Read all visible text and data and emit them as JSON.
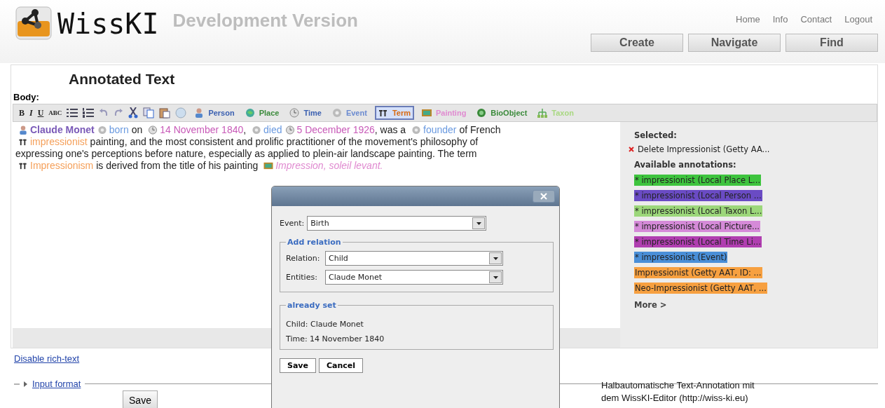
{
  "header": {
    "logo_text": "WissKI",
    "subtitle": "Development Version",
    "top_links": [
      "Home",
      "Info",
      "Contact",
      "Logout"
    ],
    "nav_buttons": [
      "Create",
      "Navigate",
      "Find"
    ]
  },
  "page_title": "Annotated Text",
  "body_label": "Body:",
  "toolbar": {
    "format_buttons": [
      {
        "kind": "bold",
        "label": "B"
      },
      {
        "kind": "italic",
        "label": "I"
      },
      {
        "kind": "underline",
        "label": "U"
      },
      {
        "kind": "spell",
        "label": "ABC"
      }
    ],
    "annotation_buttons": [
      {
        "label": "Person",
        "kind": "person",
        "color": "#3a5fb0",
        "selected": false
      },
      {
        "label": "Place",
        "kind": "place",
        "color": "#3a8a3a",
        "selected": false
      },
      {
        "label": "Time",
        "kind": "time",
        "color": "#3a5fb0",
        "selected": false
      },
      {
        "label": "Event",
        "kind": "event",
        "color": "#6a8ad0",
        "selected": false
      },
      {
        "label": "Term",
        "kind": "term",
        "color": "#d86a10",
        "selected": true
      },
      {
        "label": "Painting",
        "kind": "painting",
        "color": "#e08ad0",
        "selected": false
      },
      {
        "label": "BioObject",
        "kind": "bio",
        "color": "#3a8a3a",
        "selected": false
      },
      {
        "label": "Taxon",
        "kind": "taxon",
        "color": "#a8d880",
        "selected": false
      }
    ]
  },
  "editor": {
    "segments": [
      {
        "kind": "person",
        "text": "Claude Monet",
        "color": "#7a5ab8"
      },
      {
        "kind": "event",
        "text": "born",
        "color": "#6a9ae0"
      },
      {
        "kind": "plain",
        "text": " on "
      },
      {
        "kind": "time",
        "text": "14 November 1840",
        "color": "#c85ab8"
      },
      {
        "kind": "plain",
        "text": ", "
      },
      {
        "kind": "event",
        "text": "died",
        "color": "#6a9ae0"
      },
      {
        "kind": "time",
        "text": "5 December 1926",
        "color": "#c85ab8"
      },
      {
        "kind": "plain",
        "text": ", was a "
      },
      {
        "kind": "event",
        "text": "founder",
        "color": "#6a9ae0"
      },
      {
        "kind": "plain",
        "text": " of French"
      },
      {
        "kind": "break"
      },
      {
        "kind": "term",
        "text": "impressionist",
        "color": "#f5a05a"
      },
      {
        "kind": "plain",
        "text": " painting, and the most consistent and prolific practitioner of the movement's philosophy of"
      },
      {
        "kind": "break"
      },
      {
        "kind": "plain",
        "text": "expressing one's perceptions before nature, especially as applied to plein-air landscape painting. The term"
      },
      {
        "kind": "break"
      },
      {
        "kind": "term",
        "text": "Impressionism",
        "color": "#f5a05a"
      },
      {
        "kind": "plain",
        "text": " is derived from the title of his painting "
      },
      {
        "kind": "painting",
        "text": "Impression, soleil levant.",
        "color": "#e08ad0"
      }
    ]
  },
  "side_panel": {
    "selected_heading": "Selected:",
    "selected_item": "Delete Impressionist (Getty AA...",
    "available_heading": "Available annotations:",
    "annotations": [
      {
        "label": "* impressionist (Local Place L...",
        "color": "#3ec43e"
      },
      {
        "label": "* impressionist (Local Person ...",
        "color": "#6a4bc4"
      },
      {
        "label": "* impressionist (Local Taxon L...",
        "color": "#9cd77a"
      },
      {
        "label": "* impressionist (Local Picture...",
        "color": "#d58ad8"
      },
      {
        "label": "* impressionist (Local Time Li...",
        "color": "#b03eb0"
      },
      {
        "label": "* impressionist (Event)",
        "color": "#4a8fd8"
      },
      {
        "label": "Impressionist (Getty AAT, ID: ...",
        "color": "#f7a040"
      },
      {
        "label": "Neo-Impressionist (Getty AAT, ...",
        "color": "#f7a040"
      }
    ],
    "more": "More >"
  },
  "disable_link": "Disable rich-text",
  "input_format": "Input format",
  "save_button": "Save",
  "dialog": {
    "event_label": "Event:",
    "event_value": "Birth",
    "add_relation": "Add relation",
    "relation_label": "Relation:",
    "relation_value": "Child",
    "entities_label": "Entities:",
    "entities_value": "Claude Monet",
    "already_set": "already set",
    "set_items": [
      "Child: Claude Monet",
      "Time: 14 November 1840"
    ],
    "buttons": [
      "Save",
      "Cancel"
    ]
  },
  "caption": [
    "Halbautomatische Text-Annotation mit",
    "dem WissKI-Editor (http://wiss-ki.eu)"
  ]
}
